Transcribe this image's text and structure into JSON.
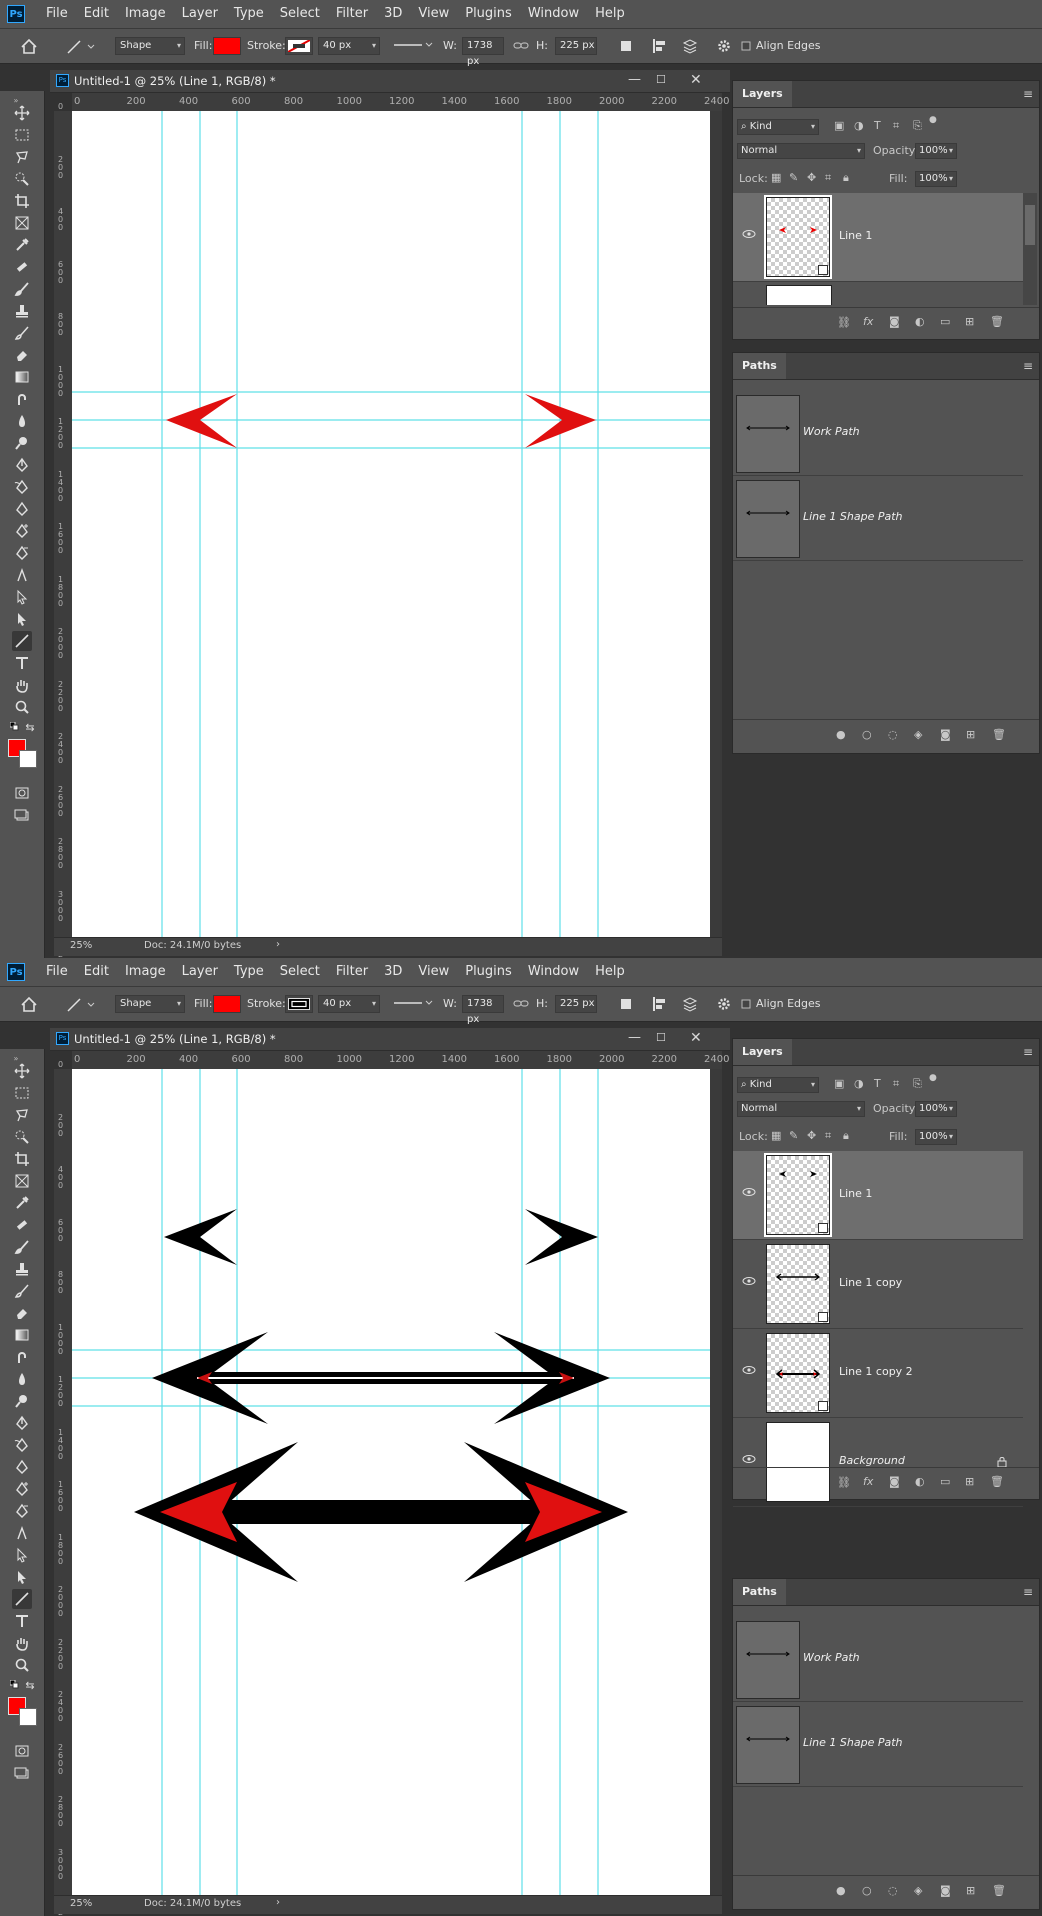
{
  "app": {
    "menu": [
      "File",
      "Edit",
      "Image",
      "Layer",
      "Type",
      "Select",
      "Filter",
      "3D",
      "View",
      "Plugins",
      "Window",
      "Help"
    ]
  },
  "options": {
    "mode": "Shape",
    "fill_label": "Fill:",
    "stroke_label": "Stroke:",
    "stroke_width": "40 px",
    "w_label": "W:",
    "width": "1738 px",
    "h_label": "H:",
    "height": "225 px",
    "align_edges": "Align Edges",
    "fill_color": "#ff0000"
  },
  "document": {
    "title": "Untitled-1 @ 25% (Line 1, RGB/8) *",
    "ruler_x": [
      "0",
      "200",
      "400",
      "600",
      "800",
      "1000",
      "1200",
      "1400",
      "1600",
      "1800",
      "2000",
      "2200",
      "2400"
    ],
    "ruler_y": [
      [
        "0"
      ],
      [
        "2",
        "0",
        "0"
      ],
      [
        "4",
        "0",
        "0"
      ],
      [
        "6",
        "0",
        "0"
      ],
      [
        "8",
        "0",
        "0"
      ],
      [
        "1",
        "0",
        "0",
        "0"
      ],
      [
        "1",
        "2",
        "0",
        "0"
      ],
      [
        "1",
        "4",
        "0",
        "0"
      ],
      [
        "1",
        "6",
        "0",
        "0"
      ],
      [
        "1",
        "8",
        "0",
        "0"
      ],
      [
        "2",
        "0",
        "0",
        "0"
      ],
      [
        "2",
        "2",
        "0",
        "0"
      ],
      [
        "2",
        "4",
        "0",
        "0"
      ],
      [
        "2",
        "6",
        "0",
        "0"
      ],
      [
        "2",
        "8",
        "0",
        "0"
      ],
      [
        "3",
        "0",
        "0",
        "0"
      ],
      [
        "3",
        "2",
        "0",
        "0"
      ]
    ],
    "zoom": "25%",
    "doc_size": "Doc: 24.1M/0 bytes"
  },
  "layers_panel": {
    "tab": "Layers",
    "kind": "Kind",
    "blend": "Normal",
    "opacity_label": "Opacity:",
    "opacity": "100%",
    "lock_label": "Lock:",
    "fill_label": "Fill:",
    "fill": "100%"
  },
  "screen1": {
    "stroke_color": "#ffffff",
    "layers": [
      {
        "name": "Line 1"
      }
    ],
    "paths": [
      {
        "name": "Work Path"
      },
      {
        "name": "Line 1 Shape Path"
      }
    ]
  },
  "screen2": {
    "stroke_color": "#000000",
    "layers": [
      {
        "name": "Line 1"
      },
      {
        "name": "Line 1 copy"
      },
      {
        "name": "Line 1 copy 2"
      },
      {
        "name": "Background"
      }
    ],
    "paths": [
      {
        "name": "Work Path"
      },
      {
        "name": "Line 1 Shape Path"
      }
    ]
  },
  "paths_panel": {
    "tab": "Paths"
  },
  "colors": {
    "foreground": "#ff0000",
    "background": "#ffffff",
    "guide": "#5fe0e8"
  }
}
